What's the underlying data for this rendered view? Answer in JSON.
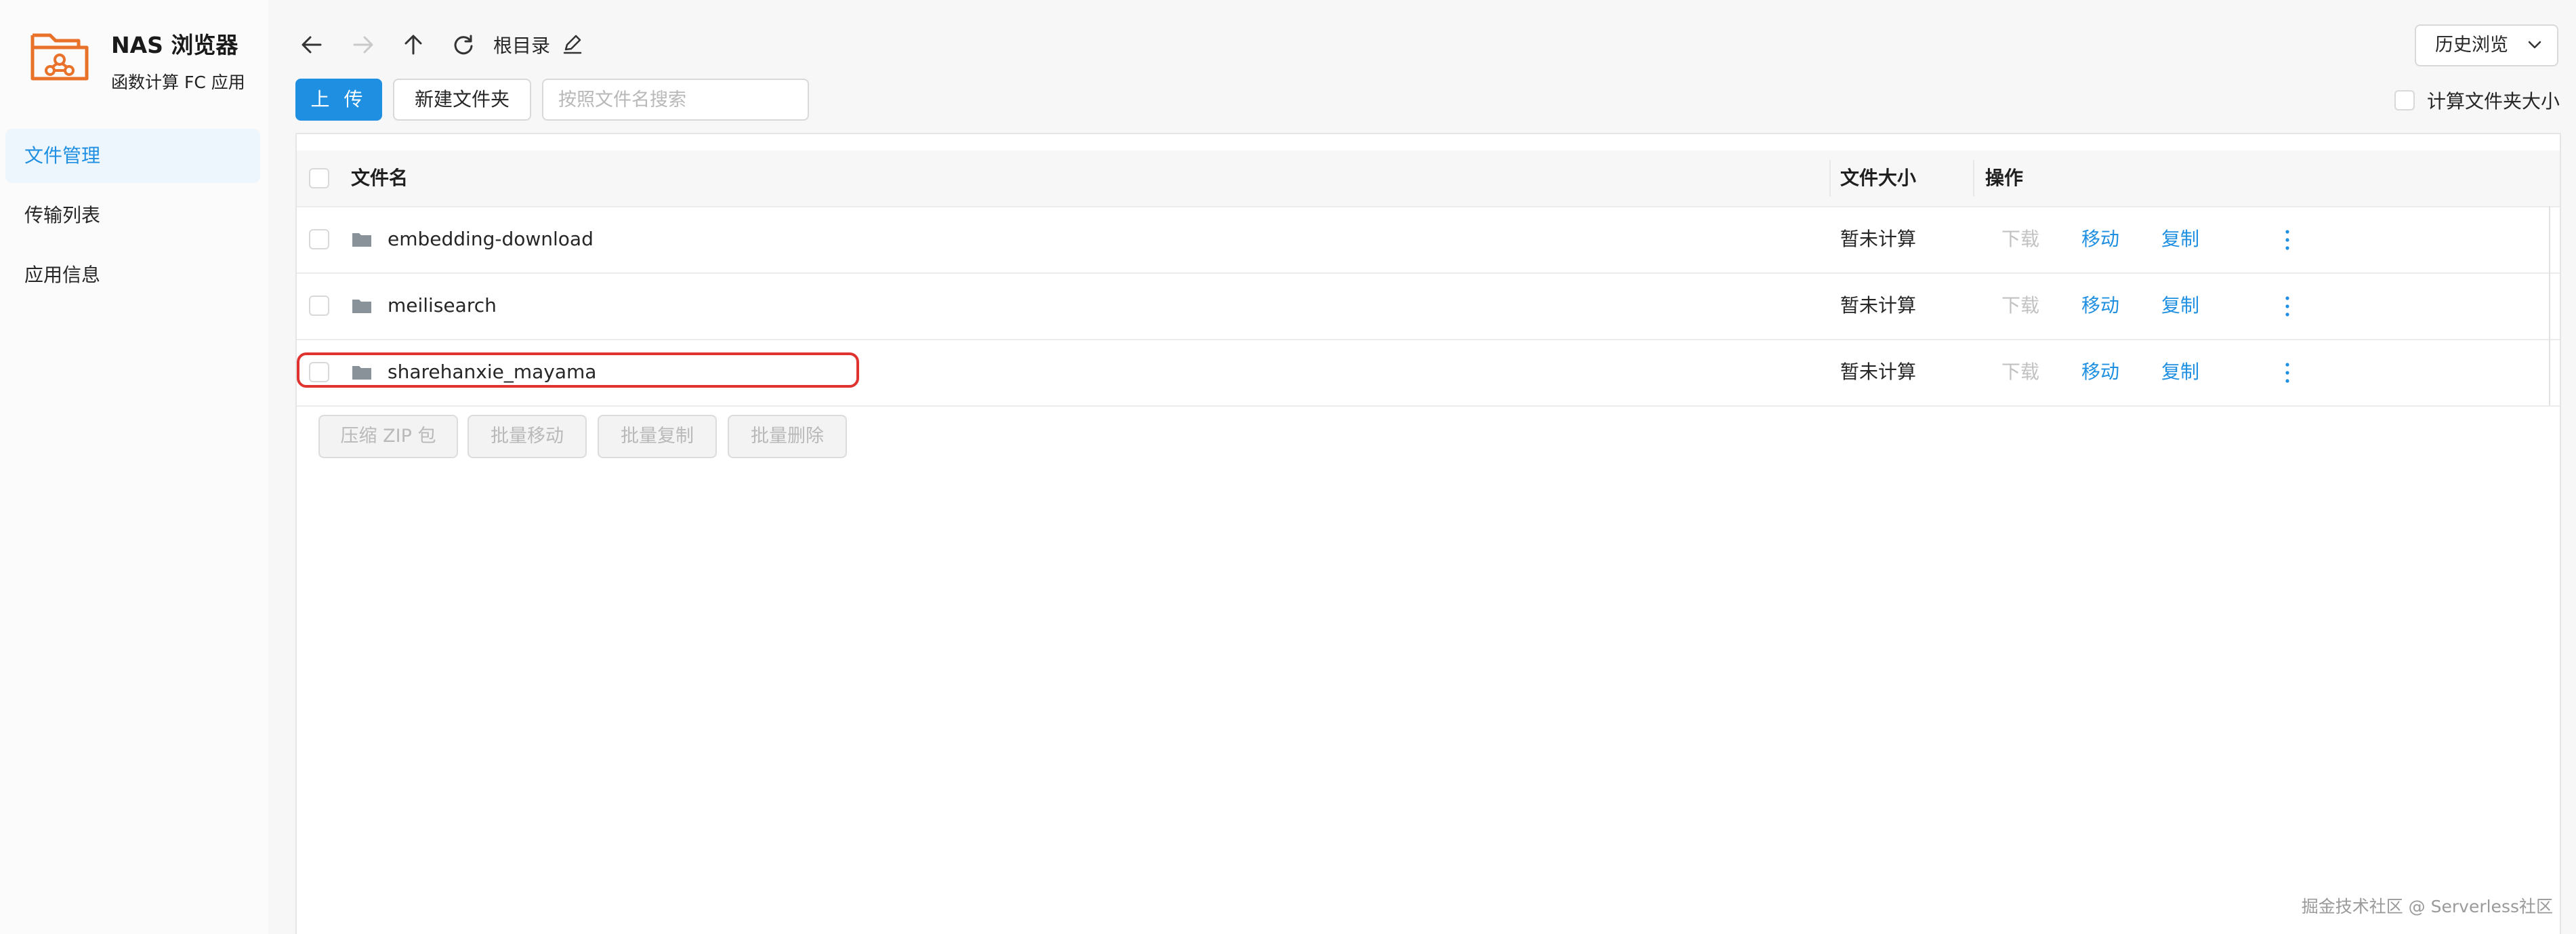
{
  "app": {
    "title": "NAS 浏览器",
    "subtitle": "函数计算 FC 应用",
    "brand_color": "#e8722a"
  },
  "sidebar": {
    "items": [
      {
        "label": "文件管理",
        "active": true
      },
      {
        "label": "传输列表",
        "active": false
      },
      {
        "label": "应用信息",
        "active": false
      }
    ],
    "collapse_label": "<"
  },
  "toolbar": {
    "icons": [
      "back-arrow-icon",
      "forward-arrow-icon",
      "up-arrow-icon",
      "refresh-icon"
    ],
    "breadcrumb": "根目录",
    "history_label": "历史浏览",
    "upload_label": "上 传",
    "new_folder_label": "新建文件夹",
    "search_placeholder": "按照文件名搜索",
    "search_value": "",
    "calc_size_label": "计算文件夹大小",
    "calc_size_checked": false
  },
  "table": {
    "columns": [
      "文件名",
      "文件大小",
      "操作"
    ],
    "rows": [
      {
        "name": "embedding-download",
        "size": "暂未计算",
        "selected": false,
        "highlighted": false
      },
      {
        "name": "meilisearch",
        "size": "暂未计算",
        "selected": false,
        "highlighted": false
      },
      {
        "name": "sharehanxie_mayama",
        "size": "暂未计算",
        "selected": false,
        "highlighted": true
      }
    ],
    "actions": {
      "download": "下载",
      "move": "移动",
      "copy": "复制"
    },
    "action_colors": {
      "link": "#1e8fe1",
      "disabled": "#c2c2c2"
    }
  },
  "batch_actions": [
    "压缩 ZIP 包",
    "批量移动",
    "批量复制",
    "批量删除"
  ],
  "watermark": "掘金技术社区 @ Serverless社区",
  "accent_color": "#1e8fe1",
  "highlight_color": "#e0322e"
}
